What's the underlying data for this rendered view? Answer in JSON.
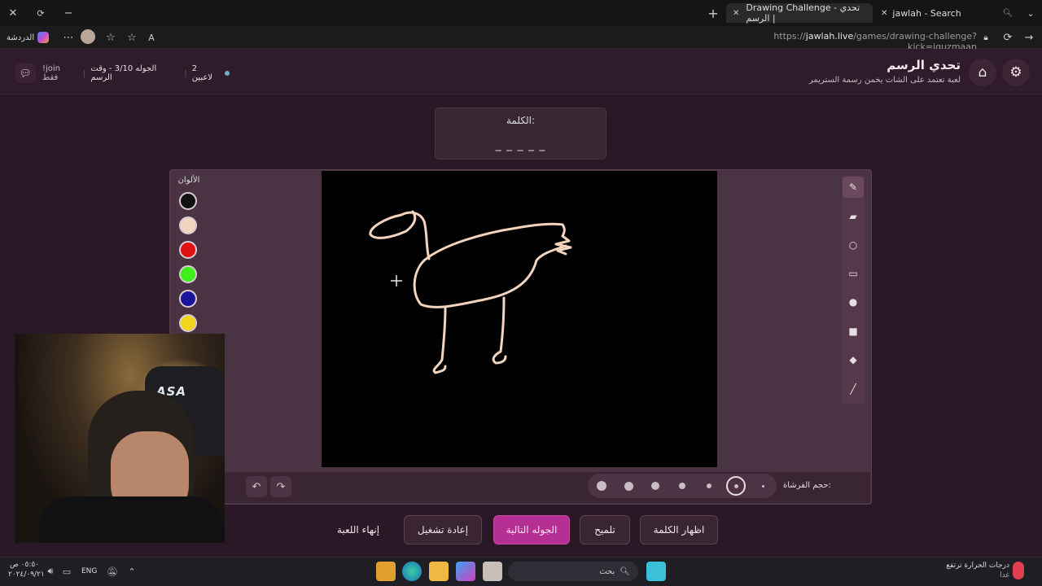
{
  "browser": {
    "tabs": [
      {
        "label": "Drawing Challenge - تحدي الرسم |",
        "active": true
      },
      {
        "label": "jawlah - Search",
        "active": false
      }
    ],
    "sidebar_label": "الدردشة",
    "url_prefix": "https://",
    "url_domain": "jawlah.live",
    "url_path": "/games/drawing-challenge?kick=iguzmaan"
  },
  "header": {
    "title": "تحدي الرسم",
    "subtitle": "لعبة تعتمد على الشات يخمن رسمة الستريمر",
    "players": "2 لاعبين",
    "round": "الجوله 3/10 - وقت الرسم",
    "join": "!join فقط"
  },
  "word": {
    "label": "الكلمة:",
    "mask": "_ _ _ _ _"
  },
  "colors": {
    "label": "الألوان",
    "swatches": [
      "#111111",
      "#f2d4bf",
      "#e01010",
      "#3cf01a",
      "#1a149a",
      "#f3d51c"
    ]
  },
  "brush": {
    "label": "حجم الفرشاة:",
    "selected_index": 1
  },
  "actions": {
    "reveal_word": "اظهار الكلمة",
    "hint": "تلميح",
    "next_round": "الجوله التالية",
    "restart": "إعادة تشغيل",
    "end_game": "إنهاء اللعبة"
  },
  "webcam": {
    "logo_text": "ASA"
  },
  "taskbar": {
    "search": "بحث",
    "weather": "درجات الحرارة ترتفع",
    "weather_sub": "غدا",
    "lang": "ENG",
    "time": "٠٥:٥٠ ص",
    "date": "٢٠٢٤/٠٩/٢١"
  },
  "drawing_color": "#f2d4bf"
}
